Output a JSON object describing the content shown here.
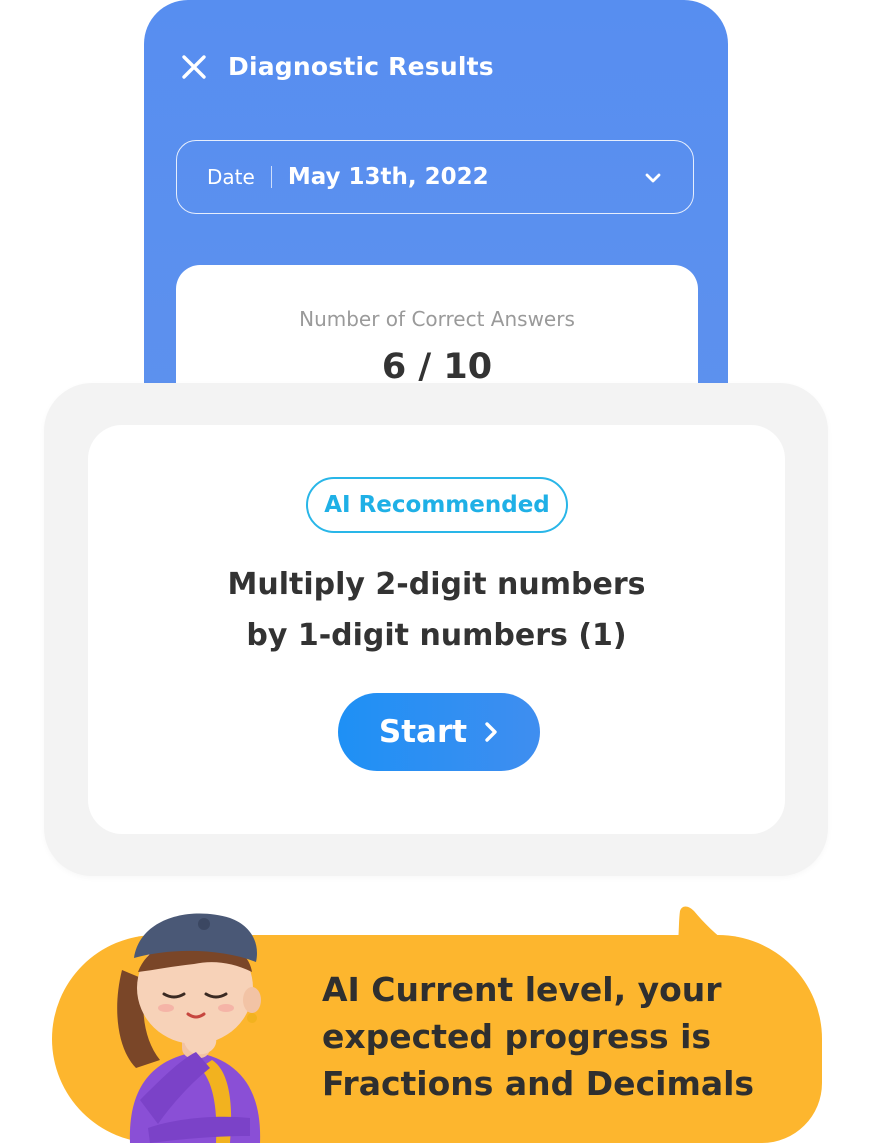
{
  "header": {
    "title": "Diagnostic Results"
  },
  "date_select": {
    "label": "Date",
    "value": "May 13th, 2022"
  },
  "result": {
    "label": "Number of Correct Answers",
    "value": "6 / 10"
  },
  "recommendation": {
    "badge": "AI Recommended",
    "title_line1": "Multiply 2-digit numbers",
    "title_line2": "by 1-digit numbers (1)",
    "start_label": "Start"
  },
  "bubble": {
    "line1": "AI Current level, your",
    "line2": "expected progress is",
    "line3": "Fractions and Decimals"
  },
  "colors": {
    "phone_bg": "#578ef0",
    "badge_accent": "#29b6e8",
    "start_button": "#1e90f5",
    "bubble_bg": "#fdb62e"
  },
  "icons": [
    "close-icon",
    "chevron-down-icon",
    "chevron-right-icon",
    "character-illustration"
  ]
}
